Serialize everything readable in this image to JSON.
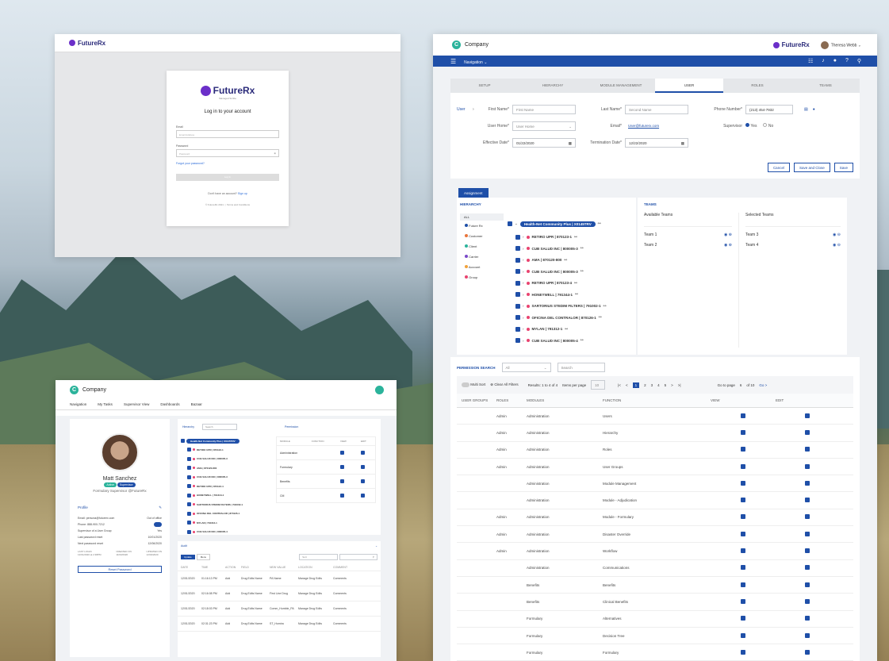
{
  "login": {
    "brand": "FutureRx",
    "brand_sub": "Managed Scribe",
    "heading": "Log in to your account",
    "email_label": "Email",
    "email_placeholder": "Email Address",
    "password_label": "Password",
    "password_placeholder": "Password",
    "forgot": "Forgot your password?",
    "login_btn": "Log In",
    "no_account": "Don't have an account?",
    "signup": "Sign up",
    "copyright": "© FutureRx 2021",
    "terms": "Terms and Conditions"
  },
  "main": {
    "company": "Company",
    "brand": "FutureRx",
    "user_name": "Theresa Webb",
    "nav_label": "Navigation",
    "tabs": [
      "SETUP",
      "HIERARCHY",
      "MODULE MANAGEMENT",
      "USER",
      "ROLES",
      "TEAMS"
    ],
    "form": {
      "crumb": "User",
      "first_name_label": "First Name*",
      "first_name_ph": "First Name",
      "last_name_label": "Last Name*",
      "last_name_ph": "Second Name",
      "phone_label": "Phone Number*",
      "phone_val": "(213) 454-7932",
      "user_home_label": "User Home*",
      "user_home_val": "User Home",
      "email_label": "Email*",
      "email_val": "User@futurerx.com",
      "supervisor_label": "Supervisor",
      "yes": "Yes",
      "no": "No",
      "eff_label": "Effective Date*",
      "eff_val": "01/22/2020",
      "term_label": "Termination Date*",
      "term_val": "12/22/2020",
      "cancel": "Cancel",
      "save_close": "Save and Close",
      "save": "Save"
    },
    "assignment": "Assignment",
    "hierarchy_title": "HIERARCHY",
    "legend": [
      "ALL",
      "Future Rx",
      "Customer",
      "Client",
      "Carrier",
      "Account",
      "Group"
    ],
    "legend_colors": [
      "#ffffff",
      "#1f4fa8",
      "#e8743b",
      "#2bb39b",
      "#7a49c9",
      "#f1a23a",
      "#e9436f"
    ],
    "root": "Health-Net Community Plus  |  X0145TRV",
    "nodes": [
      "RETIRO UPR  |  870123-1",
      "CUB SALUD INC  |  800005-3",
      "AMA  |  870120-800",
      "CUB SALUD INC  |  800005-3",
      "RETIRO UPR  |  870123-4",
      "HONEYWELL  |  791344-1",
      "SARTORIUS STEDIM FILTERS  |  791002-1",
      "OFICINA DEL CONTRALOR  |  870126-1",
      "MYLAN  |  791312-1",
      "CUB SALUD INC  |  800005-4"
    ],
    "teams_title": "TEAMS",
    "available": "Available Teams",
    "selected": "Selected Teams",
    "avail_list": [
      "Team 1",
      "Team 2"
    ],
    "sel_list": [
      "Team 3",
      "Team 4"
    ],
    "perm_search": "PERMISSION SEARCH",
    "perm_filter": "All",
    "perm_search_ph": "Search",
    "multi_sort": "Multi Sort",
    "clear_filters": "Clear All Filters",
    "results": "Results: 1 to 4 of 4",
    "items_per_page": "Items per page",
    "per_page": "10",
    "pages": [
      "1",
      "2",
      "3",
      "4",
      "5"
    ],
    "go_to_page": "Go to page",
    "page_val": "6",
    "of_pages": "of 10",
    "go": "Go >",
    "headers": [
      "USER GROUPS",
      "ROLES",
      "MODULES",
      "FUNCTION",
      "VIEW",
      "EDIT"
    ],
    "rows": [
      [
        "",
        "Admin",
        "Administration",
        "Users"
      ],
      [
        "",
        "Admin",
        "Administration",
        "Hierarchy"
      ],
      [
        "",
        "Admin",
        "Administration",
        "Roles"
      ],
      [
        "",
        "Admin",
        "Administration",
        "User Groups"
      ],
      [
        "",
        "",
        "Administration",
        "Module Management"
      ],
      [
        "",
        "",
        "Administration",
        "Module - Adjudication"
      ],
      [
        "",
        "Admin",
        "Administration",
        "Module - Formulary"
      ],
      [
        "",
        "Admin",
        "Administration",
        "Disaster Override"
      ],
      [
        "",
        "Admin",
        "Administration",
        "Workflow"
      ],
      [
        "",
        "",
        "Administration",
        "Communications"
      ],
      [
        "",
        "",
        "Benefits",
        "Benefits"
      ],
      [
        "",
        "",
        "Benefits",
        "Clinical Benefits"
      ],
      [
        "",
        "",
        "Formulary",
        "Alternatives"
      ],
      [
        "",
        "",
        "Formulary",
        "Decision Tree"
      ],
      [
        "",
        "",
        "Formulary",
        "Formulary"
      ]
    ]
  },
  "profile": {
    "company": "Company",
    "nav": [
      "Navigation",
      "My Tasks",
      "Supervisor View",
      "Dashboards",
      "Bazaar"
    ],
    "name": "Matt Sanchez",
    "active": "Active",
    "role_badge": "Supervisor",
    "title": "Formulary Supervisor @FutureRx",
    "section": "Profile",
    "email": "Email: persona@futurerx.com",
    "out_office": "Out of office",
    "phone": "Phone: 888-900-7212",
    "supervisor_q": "Supervisor of a User Group",
    "supervisor_a": "Yes",
    "last_pw": "Last password reset",
    "last_pw_v": "10/01/2020",
    "next_pw": "Next password reset",
    "next_pw_v": "12/06/2020",
    "last_login": "LAST LOGIN",
    "last_login_v": "12/01/2020 at 2:38PM",
    "created": "CREATED ON",
    "created_v": "11/03/2020",
    "updated": "UPDATED ON",
    "updated_v": "12/04/2020",
    "reset_btn": "Reset Password",
    "hier_title": "Hierarchy",
    "hier_search": "Search",
    "perm_title": "Permission",
    "perm_headers": [
      "MODULE",
      "FUNCTION",
      "VIEW",
      "EDIT"
    ],
    "perm_rows": [
      "Administration",
      "Formulary",
      "Benefits",
      "CM"
    ],
    "audit_title": "Audit",
    "audit_tabs": [
      "Update",
      "Menu"
    ],
    "audit_sort": "Sort",
    "audit_headers": [
      "DATE",
      "TIME",
      "ACTION",
      "FIELD",
      "NEW VALUE",
      "LOCATION",
      "COMMENT"
    ],
    "audit_rows": [
      [
        "12/01/2020",
        "01:16:13 PM",
        "Add",
        "Drug Edits Name",
        "PA Name",
        "Manage Drug Edits",
        "Comments"
      ],
      [
        "12/01/2020",
        "02:16:08 PM",
        "Add",
        "Drug Edits Name",
        "First Line Drug",
        "Manage Drug Edits",
        "Comments"
      ],
      [
        "12/01/2020",
        "02:18:03 PM",
        "Add",
        "Drug Edits Name",
        "Comm_Humble_PA",
        "Manage Drug Edits",
        "Comments"
      ],
      [
        "12/01/2020",
        "02:31:23 PM",
        "Add",
        "Drug Edits Name",
        "ST_Humira",
        "Manage Drug Edits",
        "Comments"
      ]
    ]
  }
}
